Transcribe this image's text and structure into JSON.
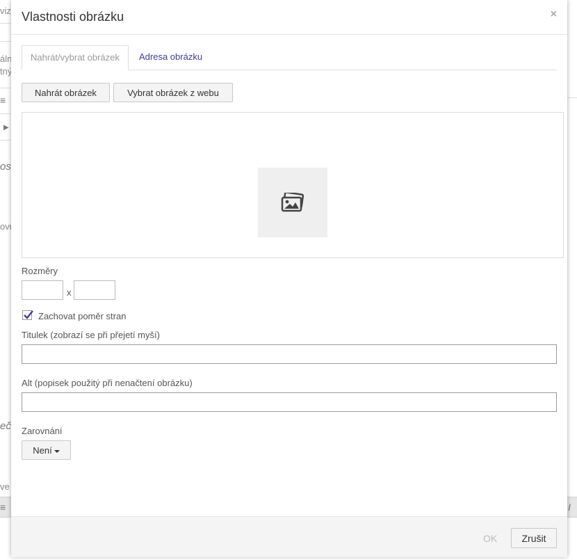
{
  "background": {
    "fragments": [
      "viz",
      "álni",
      "tný",
      "ost",
      "ovn",
      "ečí",
      "ve"
    ]
  },
  "dialog": {
    "title": "Vlastnosti obrázku",
    "close_symbol": "×",
    "tabs": [
      {
        "label": "Nahrát/vybrat obrázek",
        "active": true
      },
      {
        "label": "Adresa obrázku",
        "active": false
      }
    ],
    "upload_button": "Nahrát obrázek",
    "web_button": "Vybrat obrázek z webu",
    "preview_icon": "image-gallery-icon",
    "dimensions": {
      "label": "Rozměry",
      "width_value": "",
      "separator": "x",
      "height_value": ""
    },
    "keep_ratio": {
      "label": "Zachovat poměr stran",
      "checked": true
    },
    "title_field": {
      "label": "Titulek (zobrazí se při přejetí myší)",
      "value": ""
    },
    "alt_field": {
      "label": "Alt (popisek použitý při nenačtení obrázku)",
      "value": ""
    },
    "alignment": {
      "label": "Zarovnání",
      "selected": "Není"
    },
    "footer": {
      "ok_label": "OK",
      "cancel_label": "Zrušit"
    }
  },
  "colors": {
    "accent_link": "#3c3ca0",
    "checkbox_check": "#3c3ca0",
    "footer_bg": "#f4f4f4"
  }
}
